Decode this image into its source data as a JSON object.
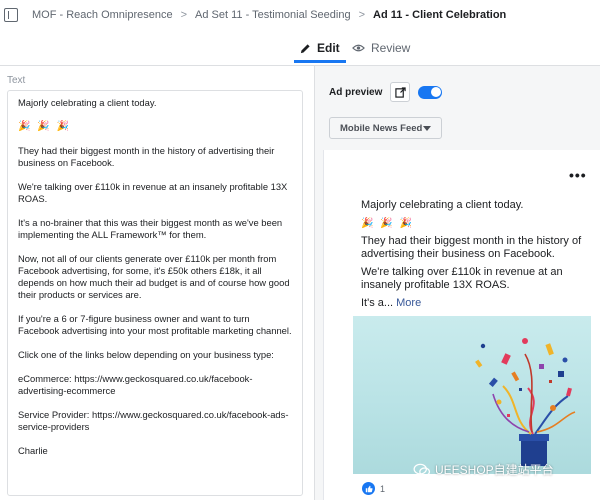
{
  "breadcrumb": {
    "items": [
      "MOF - Reach Omnipresence",
      "Ad Set 11 - Testimonial Seeding",
      "Ad 11 - Client Celebration"
    ],
    "separator": ">"
  },
  "tabs": [
    {
      "label": "Edit",
      "icon": "pencil-icon",
      "active": true
    },
    {
      "label": "Review",
      "icon": "eye-icon",
      "active": false
    }
  ],
  "editor": {
    "label": "Text",
    "paragraphs": [
      "Majorly celebrating a client today.",
      "🎉 🎉 🎉",
      "They had their biggest month in the history of advertising their business on Facebook.",
      "We're talking over £110k in revenue at an insanely profitable 13X ROAS.",
      "It's a no-brainer that this was their biggest month as we've been implementing the ALL Framework™ for them.",
      "Now, not all of our clients generate over £110k per month from Facebook advertising, for some, it's £50k others £18k, it all depends on how much their ad budget is and of course how good their products or services are.",
      "If you're a 6 or 7-figure business owner and want to turn Facebook advertising into your most profitable marketing channel.",
      "Click one of the links below depending on your business type:",
      "eCommerce: https://www.geckosquared.co.uk/facebook-advertising-ecommerce",
      "Service Provider: https://www.geckosquared.co.uk/facebook-ads-service-providers",
      "Charlie"
    ]
  },
  "preview": {
    "label": "Ad preview",
    "toggle_on": true,
    "placement": "Mobile News Feed",
    "more_menu": "•••",
    "ad_paragraphs": [
      "Majorly celebrating a client today.",
      "🎉 🎉 🎉",
      "They had their biggest month in the history of advertising their business on Facebook.",
      "We're talking over £110k in revenue at an insanely profitable 13X ROAS."
    ],
    "truncated_prefix": "It's a...",
    "more_link": "More",
    "like_count": "1"
  },
  "watermark": {
    "text": "UEESHOP自建站平台"
  },
  "colors": {
    "accent": "#1877f2",
    "link": "#385898",
    "image_bg": "#c2e7ea"
  }
}
